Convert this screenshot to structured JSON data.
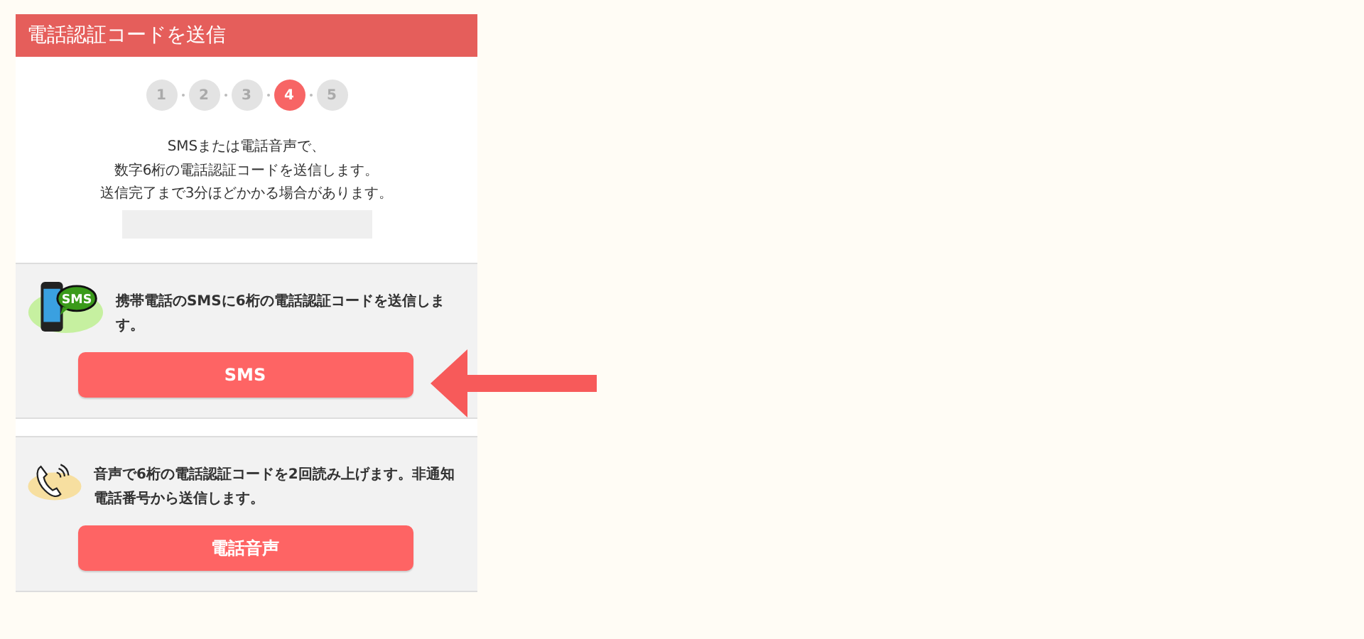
{
  "header": {
    "title": "電話認証コードを送信"
  },
  "steps": [
    {
      "label": "1",
      "selected": false
    },
    {
      "label": "2",
      "selected": false
    },
    {
      "label": "3",
      "selected": false
    },
    {
      "label": "4",
      "selected": true
    },
    {
      "label": "5",
      "selected": false
    }
  ],
  "intro": [
    "SMSまたは電話音声で、",
    "数字6桁の電話認証コードを送信します。",
    "送信完了まで3分ほどかかる場合があります。"
  ],
  "options": [
    {
      "kind": "sms",
      "icon_text": "SMS",
      "description": "携帯電話のSMSに6桁の電話認証コードを送信します。",
      "button": "SMS"
    },
    {
      "kind": "voice",
      "description": "音声で6桁の電話認証コードを2回読み上げます。非通知電話番号から送信します。",
      "button": "電話音声"
    }
  ]
}
